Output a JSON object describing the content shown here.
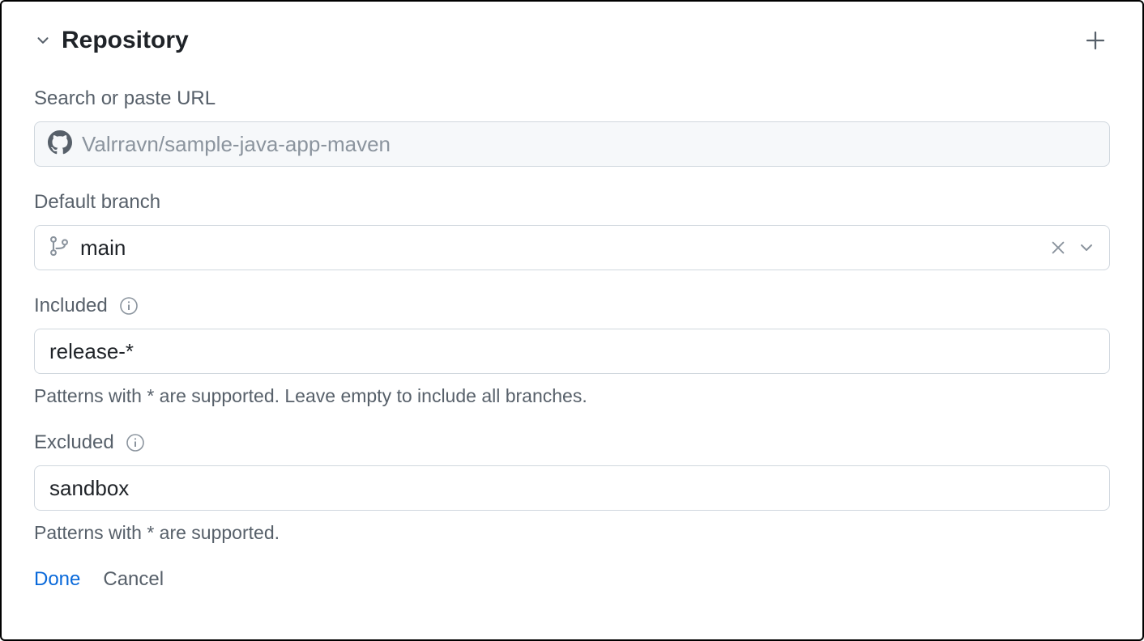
{
  "header": {
    "title": "Repository"
  },
  "repository": {
    "search_label": "Search or paste URL",
    "url_value": "Valrravn/sample-java-app-maven"
  },
  "default_branch": {
    "label": "Default branch",
    "value": "main"
  },
  "included": {
    "label": "Included",
    "value": "release-*",
    "helper": "Patterns with * are supported. Leave empty to include all branches."
  },
  "excluded": {
    "label": "Excluded",
    "value": "sandbox",
    "helper": "Patterns with * are supported."
  },
  "footer": {
    "done": "Done",
    "cancel": "Cancel"
  }
}
